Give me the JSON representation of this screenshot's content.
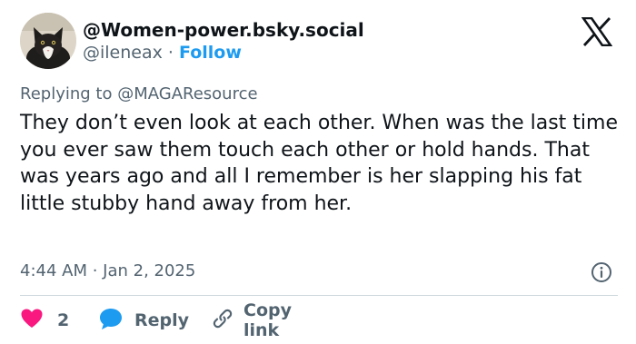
{
  "author": {
    "display_name": "@Women-power.bsky.social",
    "handle": "@ileneax",
    "separator": "·",
    "follow_label": "Follow"
  },
  "reply_context": {
    "prefix": "Replying to",
    "mention": "@MAGAResource"
  },
  "body": "They don’t even look at each other. When was the last time you ever saw them touch each other or hold hands. That was years ago and all I remember is her slapping his fat little stubby hand away from her.",
  "meta": {
    "timestamp": "4:44 AM · Jan 2, 2025"
  },
  "actions": {
    "like_count": "2",
    "reply_label": "Reply",
    "copy_label": "Copy link"
  },
  "icons": {
    "logo": "x-logo-icon",
    "info": "info-icon",
    "like": "heart-icon",
    "reply": "speech-bubble-icon",
    "copy": "link-icon"
  },
  "colors": {
    "accent": "#1d9bf0",
    "text": "#0f1419",
    "muted": "#536471",
    "like": "#f91880",
    "divider": "#cfd9de"
  }
}
